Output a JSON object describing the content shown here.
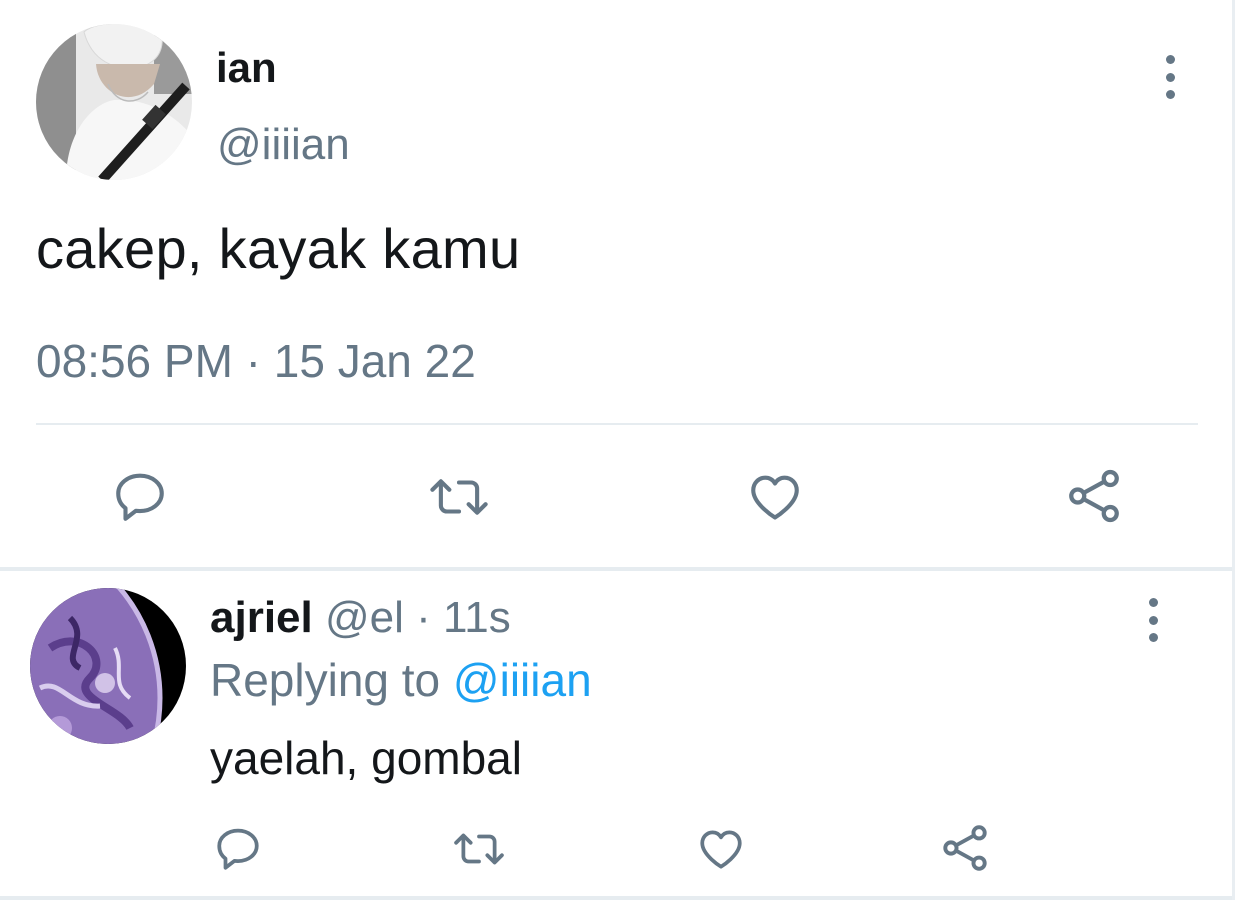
{
  "main_tweet": {
    "display_name": "ian",
    "handle": "@iiiian",
    "text": "cakep, kayak kamu",
    "timestamp": "08:56 PM · 15 Jan 22",
    "avatar": "profile-photo",
    "actions": [
      "reply-icon",
      "retweet-icon",
      "like-icon",
      "share-icon"
    ]
  },
  "reply_tweet": {
    "display_name": "ajriel",
    "handle": "@el",
    "separator": " · ",
    "time": "11s",
    "replying_prefix": "Replying to ",
    "replying_to": "@iiiian",
    "text": "yaelah, gombal",
    "avatar": "purple-planet-photo",
    "actions": [
      "reply-icon",
      "retweet-icon",
      "like-icon",
      "share-icon"
    ]
  },
  "colors": {
    "primary_text": "#14171a",
    "secondary_text": "#657786",
    "link": "#1da1f2",
    "divider": "#e6ecf0"
  }
}
